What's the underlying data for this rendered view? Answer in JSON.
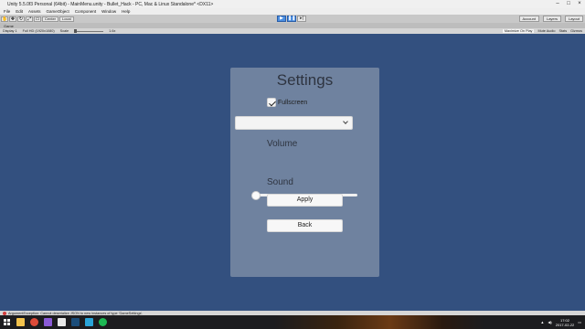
{
  "window": {
    "title": "Unity 5.5.0f3 Personal (64bit) - MainMenu.unity - Bullet_Hack - PC, Mac & Linux Standalone* <DX11>",
    "controls": [
      "–",
      "□",
      "×"
    ]
  },
  "menu": [
    "File",
    "Edit",
    "Assets",
    "GameObject",
    "Component",
    "Window",
    "Help"
  ],
  "toolbar": {
    "pivot_label": "Center",
    "space_label": "Local",
    "account_label": "Account",
    "layers_label": "Layers",
    "layout_label": "Layout"
  },
  "tab": {
    "label": "Game"
  },
  "game_view": {
    "display": "Display 1",
    "aspect": "Full HD (1920x1080)",
    "scale_label": "Scale",
    "scale_value": "1.6x",
    "options": [
      "Maximize On Play",
      "Mute Audio",
      "Stats",
      "Gizmos"
    ]
  },
  "settings": {
    "title": "Settings",
    "fullscreen_label": "Fullscreen",
    "fullscreen_checked": true,
    "resolution_value": "",
    "volume_label": "Volume",
    "volume_level": 0.0,
    "sound_label": "Sound",
    "apply_label": "Apply",
    "back_label": "Back"
  },
  "status": {
    "message": "ArgumentException: Cannot deserialize JSON to new instances of type 'GameSettings'.",
    "color_error": "#d23c3c"
  },
  "taskbar": {
    "time": "17:02",
    "date": "2017-02-22",
    "apps": [
      "file-explorer-icon",
      "chrome-icon",
      "visual-studio-icon",
      "unity-icon",
      "steam-icon",
      "photoshop-icon",
      "spotify-icon"
    ]
  },
  "colors": {
    "background": "#33507f",
    "panel": "#6f829f",
    "play_active": "#4a8de0"
  }
}
